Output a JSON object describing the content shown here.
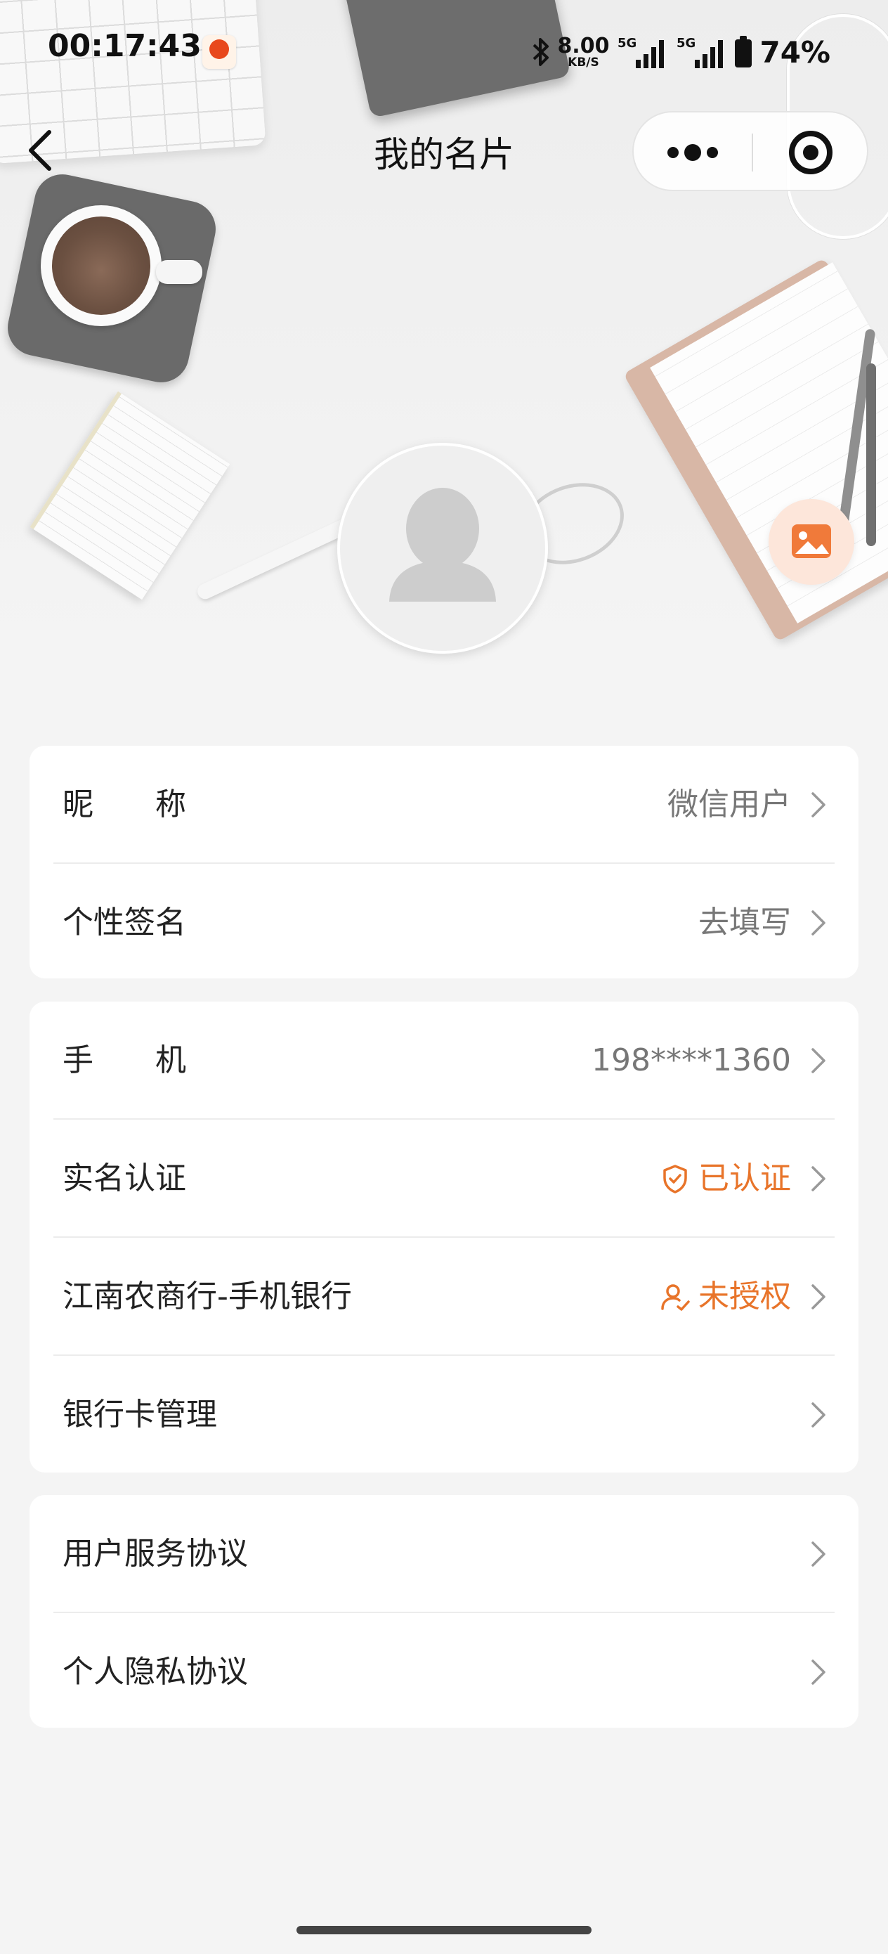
{
  "status_bar": {
    "time": "00:17:43",
    "net_speed_value": "8.00",
    "net_speed_unit": "KB/S",
    "network_1": "5G",
    "network_2": "5G",
    "battery_percent": "74%"
  },
  "nav": {
    "title": "我的名片",
    "back_icon": "chevron-left-icon",
    "more_icon": "more-dots-icon",
    "target_icon": "target-icon"
  },
  "profile": {
    "avatar_icon": "default-avatar-icon",
    "change_background_icon": "image-icon"
  },
  "groups": [
    {
      "rows": [
        {
          "label": "昵　　称",
          "value": "微信用户"
        },
        {
          "label": "个性签名",
          "value": "去填写"
        }
      ]
    },
    {
      "rows": [
        {
          "label": "手　　机",
          "value": "198****1360"
        },
        {
          "label": "实名认证",
          "value": "已认证",
          "icon": "shield-check-icon"
        },
        {
          "label": "江南农商行-手机银行",
          "value": "未授权",
          "icon": "user-check-icon"
        },
        {
          "label": "银行卡管理",
          "value": ""
        }
      ]
    },
    {
      "rows": [
        {
          "label": "用户服务协议",
          "value": ""
        },
        {
          "label": "个人隐私协议",
          "value": ""
        }
      ]
    }
  ],
  "colors": {
    "accent": "#e8742a",
    "page_background": "#f4f4f4",
    "card_background": "#ffffff"
  }
}
